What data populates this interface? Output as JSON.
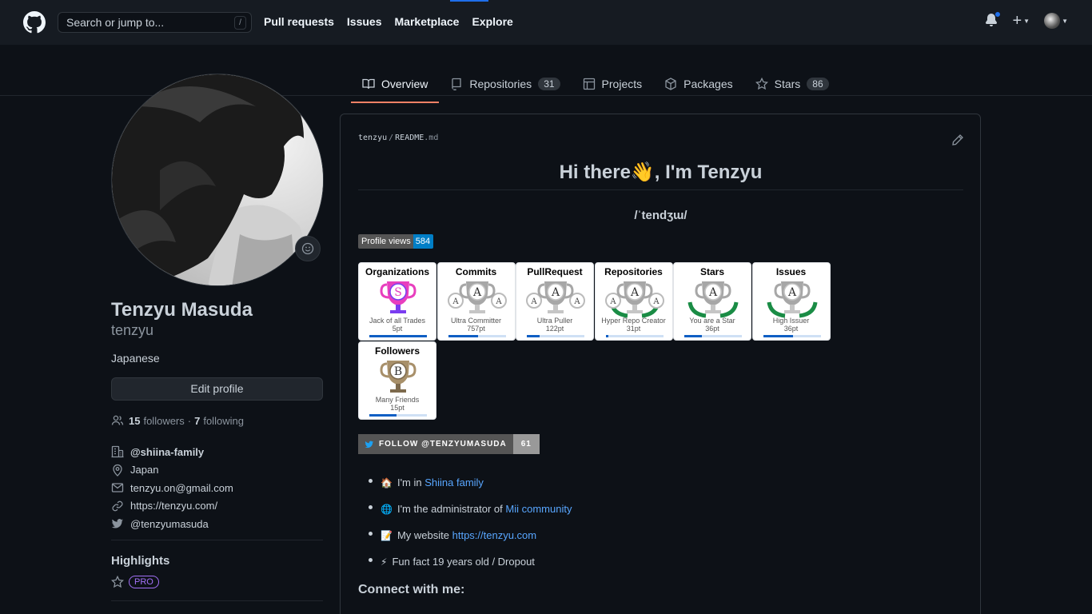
{
  "header": {
    "search_placeholder": "Search or jump to...",
    "search_shortcut": "/",
    "nav": [
      "Pull requests",
      "Issues",
      "Marketplace",
      "Explore"
    ]
  },
  "tabs": [
    {
      "label": "Overview",
      "icon": "book-icon"
    },
    {
      "label": "Repositories",
      "icon": "repo-icon",
      "count": "31"
    },
    {
      "label": "Projects",
      "icon": "project-icon"
    },
    {
      "label": "Packages",
      "icon": "package-icon"
    },
    {
      "label": "Stars",
      "icon": "star-icon",
      "count": "86"
    }
  ],
  "profile": {
    "name": "Tenzyu Masuda",
    "login": "tenzyu",
    "bio": "Japanese",
    "edit_label": "Edit profile",
    "followers_count": "15",
    "followers_label": "followers",
    "dot": "·",
    "following_count": "7",
    "following_label": "following",
    "org": "@shiina-family",
    "location": "Japan",
    "email": "tenzyu.on@gmail.com",
    "website": "https://tenzyu.com/",
    "twitter": "@tenzyumasuda",
    "highlights_title": "Highlights",
    "pro_label": "PRO"
  },
  "readme": {
    "owner": "tenzyu",
    "sep": "/",
    "file": "README",
    "ext": ".md",
    "heading": "Hi there👋, I'm Tenzyu",
    "pronunciation": "/ˈtendʒɯ/",
    "views_label": "Profile views",
    "views_count": "584",
    "trophies": [
      {
        "title": "Organizations",
        "rank": "S",
        "sub": "Jack of all Trades",
        "pt": "5pt",
        "progress": 1.0
      },
      {
        "title": "Commits",
        "rank": "A",
        "sub": "Ultra Committer",
        "pt": "757pt",
        "progress": 0.52
      },
      {
        "title": "PullRequest",
        "rank": "A",
        "sub": "Ultra Puller",
        "pt": "122pt",
        "progress": 0.22
      },
      {
        "title": "Repositories",
        "rank": "A",
        "sub": "Hyper Repo Creator",
        "pt": "31pt",
        "progress": 0.05
      },
      {
        "title": "Stars",
        "rank": "A",
        "sub": "You are a Star",
        "pt": "36pt",
        "progress": 0.31
      },
      {
        "title": "Issues",
        "rank": "A",
        "sub": "High Issuer",
        "pt": "36pt",
        "progress": 0.52
      },
      {
        "title": "Followers",
        "rank": "B",
        "sub": "Many Friends",
        "pt": "15pt",
        "progress": 0.47
      }
    ],
    "twitter_badge_label": "FOLLOW @TENZYUMASUDA",
    "twitter_badge_count": "61",
    "items": [
      {
        "emoji": "🏠",
        "text": "I'm in ",
        "link": "Shiina family"
      },
      {
        "emoji": "🌐",
        "text": "I'm the administrator of ",
        "link": "Mii community"
      },
      {
        "emoji": "📝",
        "text": "My website ",
        "link": "https://tenzyu.com"
      },
      {
        "emoji": "⚡",
        "text": "Fun fact 19 years old / Dropout",
        "link": ""
      }
    ],
    "connect_title": "Connect with me:"
  },
  "colors": {
    "bg": "#0d1117",
    "header_bg": "#161b22",
    "accent_tab": "#f78166",
    "link": "#58a6ff",
    "pro": "#a371f7"
  }
}
